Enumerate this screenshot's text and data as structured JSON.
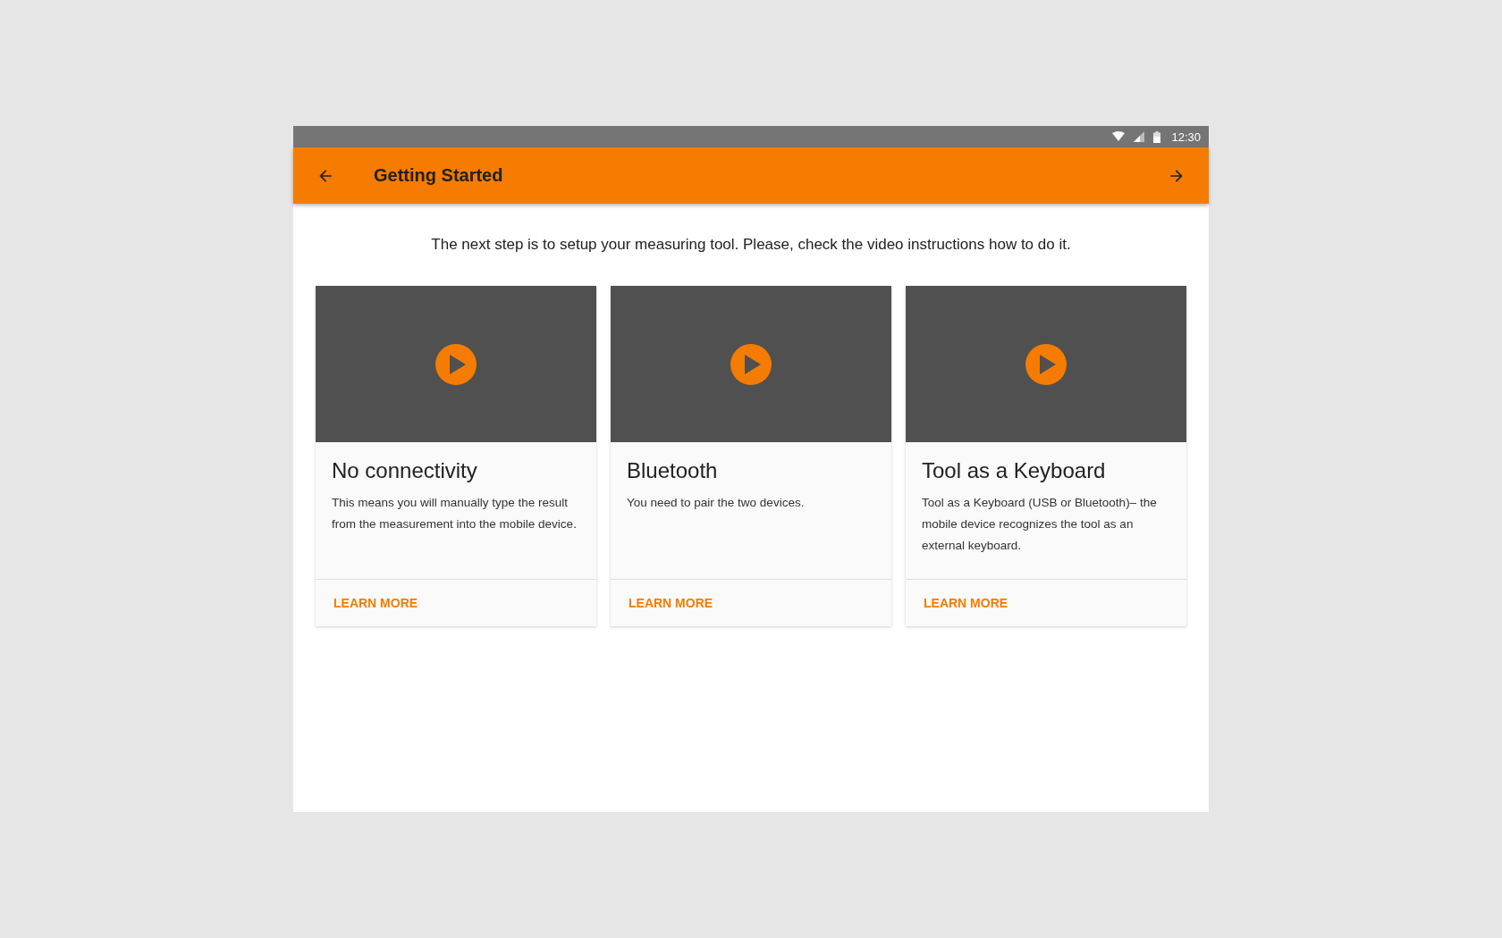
{
  "status_bar": {
    "time": "12:30"
  },
  "app_bar": {
    "title": "Getting Started"
  },
  "intro": "The next step is to setup your measuring tool. Please, check the video instructions how to do it.",
  "cards": [
    {
      "title": "No connectivity",
      "text": "This means you will manually type the result from the measurement into the mobile device.",
      "action": "LEARN MORE"
    },
    {
      "title": "Bluetooth",
      "text": "You need to pair the two devices.",
      "action": "LEARN MORE"
    },
    {
      "title": "Tool as a Keyboard",
      "text": "Tool as a Keyboard (USB or Bluetooth)– the mobile device recognizes the tool as an external keyboard.",
      "action": "LEARN MORE"
    }
  ]
}
